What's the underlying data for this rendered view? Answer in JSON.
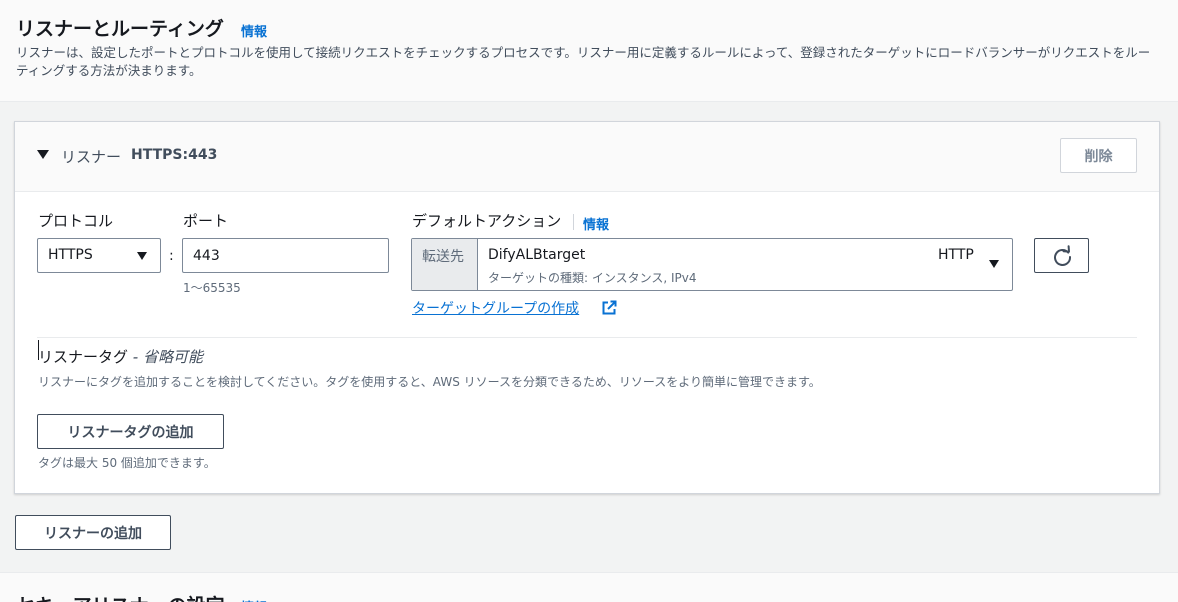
{
  "section": {
    "title": "リスナーとルーティング",
    "info_label": "情報",
    "description": "リスナーは、設定したポートとプロトコルを使用して接続リクエストをチェックするプロセスです。リスナー用に定義するルールによって、登録されたターゲットにロードバランサーがリクエストをルーティングする方法が決まります。"
  },
  "listener": {
    "header_label": "リスナー",
    "header_value": "HTTPS:443",
    "delete_label": "削除",
    "protocol_label": "プロトコル",
    "protocol_value": "HTTPS",
    "port_label": "ポート",
    "port_value": "443",
    "port_hint": "1〜65535",
    "default_action_label": "デフォルトアクション",
    "default_action_info": "情報",
    "action_prefix": "転送先",
    "target_group_name": "DifyALBtarget",
    "target_group_subtitle": "ターゲットの種類: インスタンス, IPv4",
    "target_group_protocol": "HTTP",
    "create_target_group_link": "ターゲットグループの作成",
    "tags_title": "リスナータグ",
    "tags_title_optional": " - 省略可能",
    "tags_description": "リスナーにタグを追加することを検討してください。タグを使用すると、AWS リソースを分類できるため、リソースをより簡単に管理できます。",
    "add_tag_button": "リスナータグの追加",
    "tags_limit": "タグは最大 50 個追加できます。"
  },
  "add_listener_button": "リスナーの追加",
  "next_section": {
    "title": "セキュアリスナーの設定",
    "info_label": "情報"
  },
  "colors": {
    "link": "#0972d3",
    "text": "#16191f",
    "muted": "#5f6b7a",
    "border": "#7d8998"
  }
}
